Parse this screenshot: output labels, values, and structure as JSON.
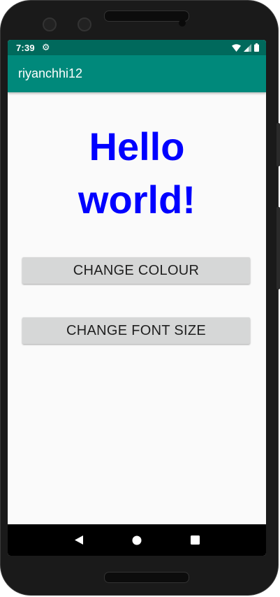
{
  "status_bar": {
    "time": "7:39",
    "settings_icon": "gear-icon",
    "wifi_icon": "wifi-icon",
    "signal_icon": "signal-icon",
    "battery_icon": "battery-icon"
  },
  "app_bar": {
    "title": "riyanchhi12"
  },
  "main": {
    "hello_line1": "Hello",
    "hello_line2": "world!",
    "hello_color": "#0000ff",
    "change_colour_label": "CHANGE COLOUR",
    "change_font_size_label": "CHANGE FONT SIZE"
  },
  "nav_bar": {
    "back_icon": "back-icon",
    "home_icon": "home-icon",
    "recents_icon": "recents-icon"
  },
  "colors": {
    "status_bar": "#00695c",
    "app_bar": "#00897b",
    "button_bg": "#d6d7d7",
    "screen_bg": "#fafafa"
  }
}
